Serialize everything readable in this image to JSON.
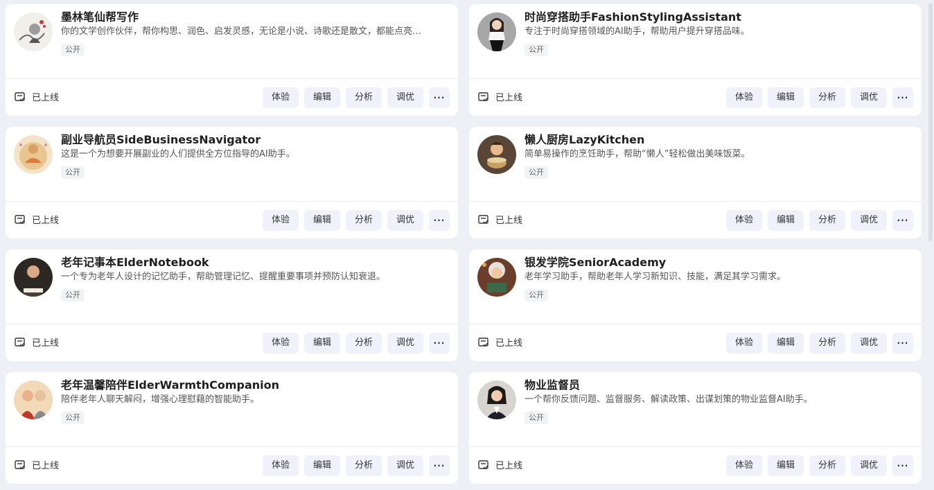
{
  "cards": [
    {
      "title": "墨林笔仙帮写作",
      "desc": "你的文学创作伙伴，帮你构思、润色、启发灵感，无论是小说、诗歌还是散文，都能点亮…",
      "tag": "公开",
      "status": "已上线",
      "avatar": "ink-painting-avatar"
    },
    {
      "title": "时尚穿搭助手FashionStylingAssistant",
      "desc": "专注于时尚穿搭领域的AI助手，帮助用户提升穿搭品味。",
      "tag": "公开",
      "status": "已上线",
      "avatar": "fashion-woman-avatar"
    },
    {
      "title": "副业导航员SideBusinessNavigator",
      "desc": "这是一个为想要开展副业的人们提供全方位指导的AI助手。",
      "tag": "公开",
      "status": "已上线",
      "avatar": "buddha-avatar"
    },
    {
      "title": "懒人厨房LazyKitchen",
      "desc": "简单易操作的烹饪助手，帮助“懒人”轻松做出美味饭菜。",
      "tag": "公开",
      "status": "已上线",
      "avatar": "chef-avatar"
    },
    {
      "title": "老年记事本ElderNotebook",
      "desc": "一个专为老年人设计的记忆助手，帮助管理记忆、提醒重要事项并预防认知衰退。",
      "tag": "公开",
      "status": "已上线",
      "avatar": "elder-man-avatar"
    },
    {
      "title": "银发学院SeniorAcademy",
      "desc": "老年学习助手，帮助老年人学习新知识、技能，满足其学习需求。",
      "tag": "公开",
      "status": "已上线",
      "avatar": "elder-woman-book-avatar"
    },
    {
      "title": "老年温馨陪伴ElderWarmthCompanion",
      "desc": "陪伴老年人聊天解闷，增强心理慰藉的智能助手。",
      "tag": "公开",
      "status": "已上线",
      "avatar": "elder-couple-avatar"
    },
    {
      "title": "物业监督员",
      "desc": "一个帮你反馈问题、监督服务、解读政策、出谋划策的物业监督AI助手。",
      "tag": "公开",
      "status": "已上线",
      "avatar": "businesswoman-avatar"
    }
  ],
  "actions": {
    "try": "体验",
    "edit": "编辑",
    "analyze": "分析",
    "tune": "调优",
    "more": "···"
  }
}
